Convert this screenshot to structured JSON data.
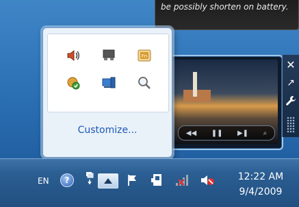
{
  "balloon": {
    "text": "be possibly shorten on battery."
  },
  "popup": {
    "icons": [
      {
        "name": "speaker-icon"
      },
      {
        "name": "display-icon"
      },
      {
        "name": "fn-key-icon"
      },
      {
        "name": "update-icon"
      },
      {
        "name": "computer-icon"
      },
      {
        "name": "magnifier-icon"
      }
    ],
    "customize_label": "Customize..."
  },
  "player": {
    "controls": [
      "◀◀",
      "❚❚",
      "▶❚",
      "⌕"
    ]
  },
  "sidebar": {
    "buttons": [
      {
        "name": "close-icon",
        "glyph": "✕"
      },
      {
        "name": "resize-icon",
        "glyph": "↗"
      },
      {
        "name": "wrench-icon",
        "glyph": "🔧"
      }
    ]
  },
  "taskbar": {
    "language": "EN",
    "help_glyph": "?",
    "clock": {
      "time": "12:22 AM",
      "date": "9/4/2009"
    }
  },
  "colors": {
    "desktop": "#2c70b4",
    "taskbar": "#2b5e92",
    "link": "#1d59b6"
  }
}
